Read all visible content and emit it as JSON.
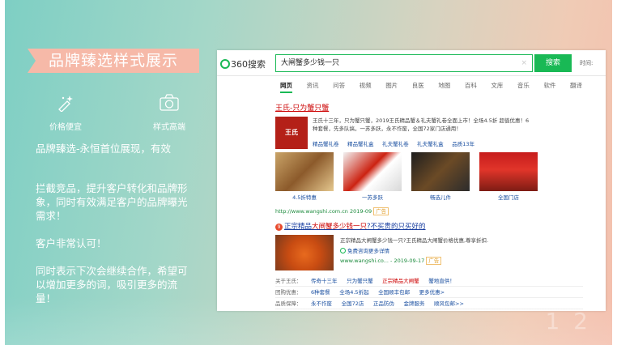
{
  "slide": {
    "banner_title": "品牌臻选样式展示",
    "features": [
      {
        "icon": "sparkle-pen-icon",
        "label": "价格便宜"
      },
      {
        "icon": "camera-icon",
        "label": "样式高端"
      }
    ],
    "paragraphs": [
      "品牌臻选-永恒首位展现，有效",
      "拦截竞品，提升客户转化和品牌形象，同时有效满足客户的品牌曝光需求！",
      "客户非常认可！",
      "同时表示下次会继续合作，希望可以增加更多的词，吸引更多的流量！"
    ],
    "watermark": "1 2"
  },
  "search": {
    "logo_text": "360搜索",
    "query": "大闸蟹多少钱一只",
    "clear": "×",
    "button_label": "搜索",
    "time_label": "时间:",
    "tabs": [
      "网页",
      "资讯",
      "问答",
      "视频",
      "图片",
      "良医",
      "地图",
      "百科",
      "文库",
      "音乐",
      "软件",
      "翻译"
    ],
    "active_tab": "网页"
  },
  "result1": {
    "title": "王氏-只为蟹只蟹",
    "logo_text": "王氏",
    "description": "王氏十三年，只为蟹只蟹，2019王氏精品蟹＆礼夫蟹礼卷全面上市！全场4.5折 超值优惠！6种套餐，先多队搞，一苏多跃，永不作废，全国72家门店通用！",
    "links": [
      "精品蟹礼卷",
      "精品蟹礼盒",
      "礼夫蟹礼卷",
      "礼夫蟹礼盒",
      "品质13年"
    ],
    "thumbs": [
      "4.5折特惠",
      "一苏多跃",
      "畅选儿件",
      "全国门店"
    ],
    "url": "http://www.wangshi.com.cn 2019-09",
    "url_tag": "广告"
  },
  "result2": {
    "badge": "9",
    "title_pre": "正宗精品",
    "title_hl": "大闸蟹多少钱一只",
    "title_post": "?不买贵的只买好的",
    "description": "正宗精品大闸蟹多少钱一只?王氏精品大闸蟹价格优惠,尊享折扣.",
    "sub_link": "免费咨询更多详情",
    "url": "www.wangshi.co... - 2019-09-17",
    "url_tag": "广告"
  },
  "rows": [
    {
      "key": "关于王氏：",
      "values": [
        "传奇十三年",
        "只为蟹只蟹",
        "正宗精品大闸蟹",
        "蟹地直供！"
      ],
      "highlight": 2
    },
    {
      "key": "团购优惠：",
      "values": [
        "6种套餐",
        "全场4.5折起",
        "全国顺丰包邮",
        "更多优惠>"
      ],
      "highlight": -1
    },
    {
      "key": "品质保障：",
      "values": [
        "永不作废",
        "全国72店",
        "正品防伪",
        "金牌服务",
        "顺风包邮>>"
      ],
      "highlight": -1
    }
  ]
}
